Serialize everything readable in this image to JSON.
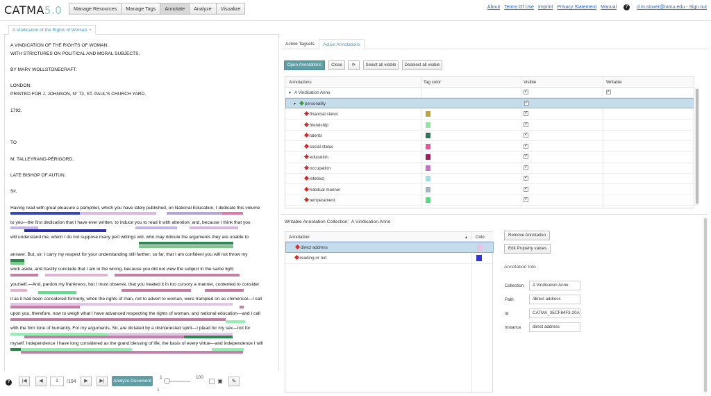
{
  "app": {
    "logo_text": "CATMA",
    "logo_version": "5.0"
  },
  "nav": {
    "items": [
      "Manage Resources",
      "Manage Tags",
      "Annotate",
      "Analyze",
      "Visualize"
    ],
    "active": "Annotate"
  },
  "top_links": {
    "about": "About",
    "terms": "Terms Of Use",
    "imprint": "Imprint",
    "privacy": "Privacy Statement",
    "manual": "Manual",
    "user": "d.m.stover@tamu.edu - Sign out"
  },
  "doc_tab": {
    "title": "A Vindication of the Rights of Woman",
    "close": "×"
  },
  "document": {
    "lines": [
      "A VINDICATION OF THE RIGHTS OF WOMAN:",
      "WITH STRICTURES ON POLITICAL AND MORAL SUBJECTS,",
      "BY MARY WOLLSTONECRAFT.",
      "LONDON:",
      "PRINTED FOR J. JOHNSON, N° 72, ST. PAUL'S CHURCH YARD.",
      "1792.",
      "TO",
      "M. TALLEYRAND-PÉRIGORD,",
      "LATE BISHOP OF AUTUN.",
      "Sir,",
      "Having read with great pleasure a pamphlet, which you have lately published, on National Education, I dedicate this volume",
      "to you—the first dedication that I have ever written, to induce you to read it with attention; and, because I think that you",
      " will understand me, which I do not suppose many pert witlings will, who may ridicule the arguments they are unable to",
      "answer. But, sir, I carry my respect for your understanding still farther; so far, that I am confident you will not throw my",
      "work aside, and hastily conclude that I am in the wrong, because you did not view the subject in the same light",
      "yourself.—And, pardon my frankness, but I must observe, that you treated it in too cursory a manner, contented to consider",
      "it as it had been considered formerly, when the rights of man, not to advert to woman, were trampled on as chimerical—I call",
      " upon you, therefore, now to weigh what I have advanced respecting the rights of woman, and national education—and I call",
      "with the firm tone of humanity. For my arguments, Sir, are dictated by a disinterested spirit—I plead for my sex—not for",
      "myself. Independence I have long considered as the grand blessing of life, the basis of every virtue—and independence I will"
    ]
  },
  "footer": {
    "first": "|◀",
    "prev": "◀",
    "page": "1",
    "total": "/194",
    "next": "▶",
    "last": "▶|",
    "analyze": "Analyze Document",
    "slider_min": "1",
    "slider_max": "100",
    "slider_value": "1"
  },
  "right_tabs": [
    "Active Tagsets",
    "Active Annotations"
  ],
  "toolbar": {
    "open": "Open Annotations",
    "close": "Close",
    "refresh": "⟳",
    "select_all": "Select all visible",
    "deselect_all": "Deselect all visible"
  },
  "tag_table": {
    "headers": [
      "Annotations",
      "Tag color",
      "Visible",
      "Writable"
    ],
    "collection": "A Vindication Anno",
    "group": "personality",
    "tags": [
      {
        "name": "financial status",
        "color": "#c4a23d"
      },
      {
        "name": "friendship",
        "color": "#8fe6a1"
      },
      {
        "name": "talents",
        "color": "#2b7a52"
      },
      {
        "name": "social status",
        "color": "#e6569b"
      },
      {
        "name": "education",
        "color": "#a8185e"
      },
      {
        "name": "occupation",
        "color": "#c66fd1"
      },
      {
        "name": "intellect",
        "color": "#9ee0e8"
      },
      {
        "name": "habitual manner",
        "color": "#a9b4c2"
      },
      {
        "name": "temperament",
        "color": "#52e07a"
      }
    ]
  },
  "writable": {
    "label": "Writable Annotation Collection:",
    "collection": "A Vindication Anno",
    "headers": [
      "Annotation",
      "Colo"
    ],
    "rows": [
      {
        "name": "direct address",
        "color": "#e4c3e3"
      },
      {
        "name": "reading or not",
        "color": "#3333dd"
      }
    ]
  },
  "annotation_actions": {
    "remove": "Remove Annotation",
    "edit": "Edit Property values"
  },
  "annotation_info": {
    "title": "Annotation Info",
    "fields": [
      {
        "label": "Collection",
        "value": "A Vindication Anno"
      },
      {
        "label": "Path",
        "value": "/direct address"
      },
      {
        "label": "Id",
        "value": "CATMA_3ECF84F3-20A"
      },
      {
        "label": "Instance",
        "value": "direct address"
      }
    ]
  }
}
